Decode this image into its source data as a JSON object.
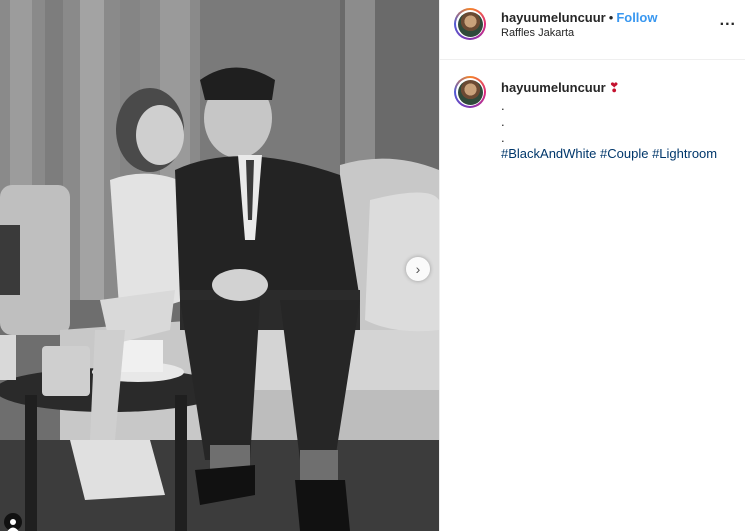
{
  "post": {
    "username": "hayuumeluncuur",
    "separator": "•",
    "follow_label": "Follow",
    "location": "Raffles Jakarta",
    "more_label": "...",
    "caption_username": "hayuumeluncuur",
    "caption_emoji": "❣",
    "caption_dots": [
      ".",
      ".",
      "."
    ],
    "hashtags": [
      "#BlackAndWhite",
      "#Couple",
      "#Lightroom"
    ]
  },
  "photo": {
    "next_label": "›"
  },
  "icons": {
    "next": "chevron-right-icon",
    "more": "more-options-icon",
    "user": "user-icon"
  },
  "colors": {
    "link": "#3897f0",
    "hashtag": "#00376b",
    "heart": "#c4122f"
  }
}
